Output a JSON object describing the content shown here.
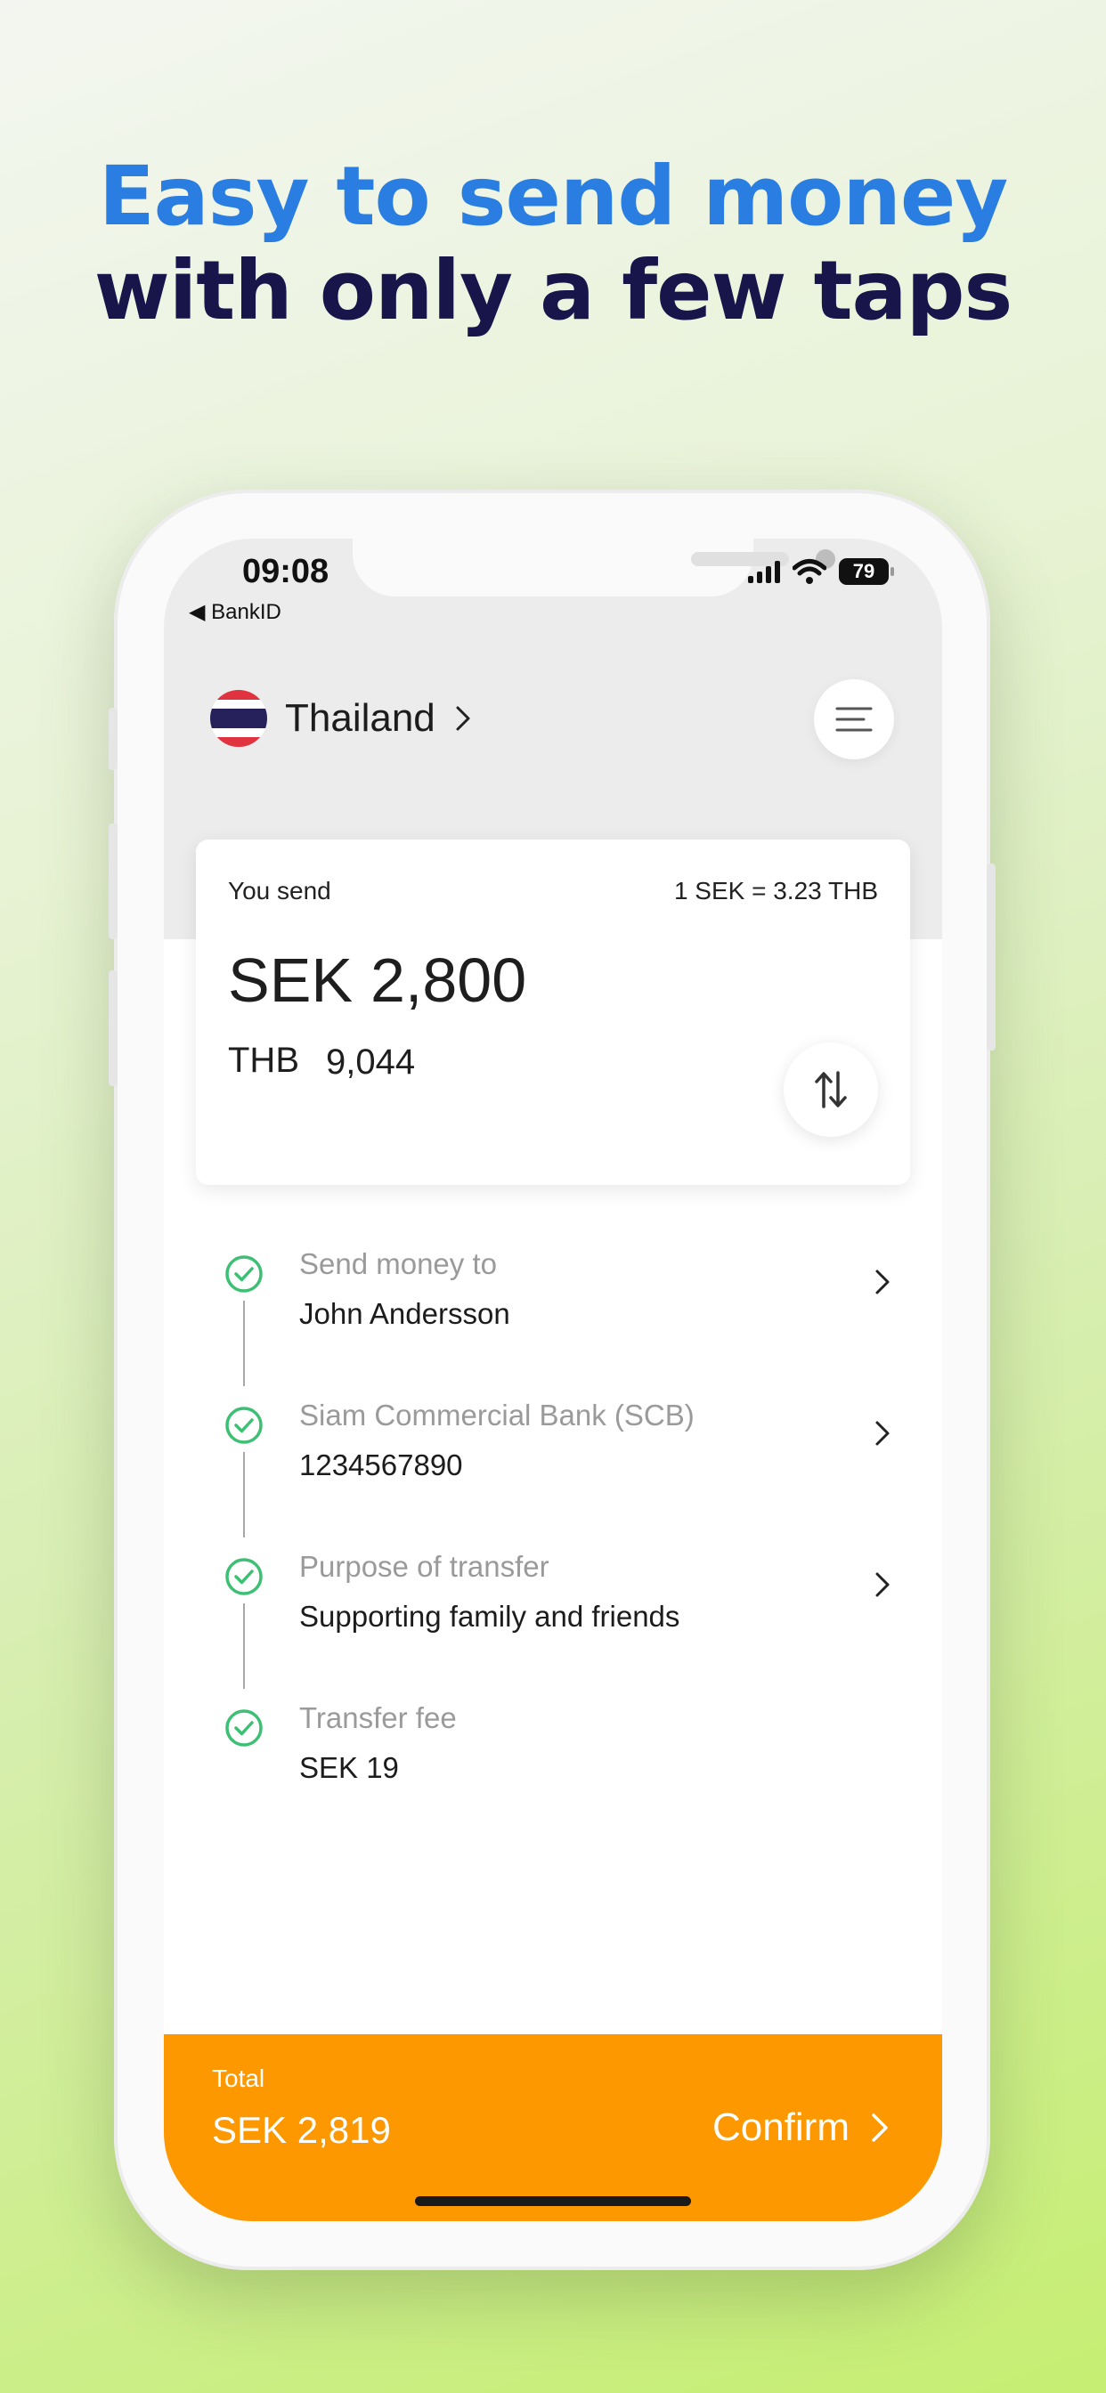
{
  "headline": {
    "line1": "Easy to send money",
    "line2": "with only a few taps"
  },
  "status_bar": {
    "time": "09:08",
    "back_app": "◀ BankID",
    "battery": "79"
  },
  "header": {
    "country": "Thailand",
    "menu_icon": "hamburger-menu-icon"
  },
  "send_card": {
    "label": "You send",
    "rate": "1 SEK = 3.23 THB",
    "send_currency": "SEK",
    "send_amount": "2,800",
    "receive_currency": "THB",
    "receive_amount": "9,044",
    "swap_icon": "swap-arrows-icon"
  },
  "steps": [
    {
      "label": "Send money to",
      "value": "John Andersson",
      "clickable": true
    },
    {
      "label": "Siam Commercial Bank (SCB)",
      "value": "1234567890",
      "clickable": true
    },
    {
      "label": "Purpose of transfer",
      "value": "Supporting family and friends",
      "clickable": true
    },
    {
      "label": "Transfer fee",
      "value": "SEK 19",
      "clickable": false
    }
  ],
  "footer": {
    "total_label": "Total",
    "total_value": "SEK 2,819",
    "confirm_label": "Confirm"
  },
  "colors": {
    "headline_blue": "#2a7de1",
    "headline_navy": "#17154a",
    "accent_orange": "#fd9800",
    "check_green": "#3dbf74"
  }
}
